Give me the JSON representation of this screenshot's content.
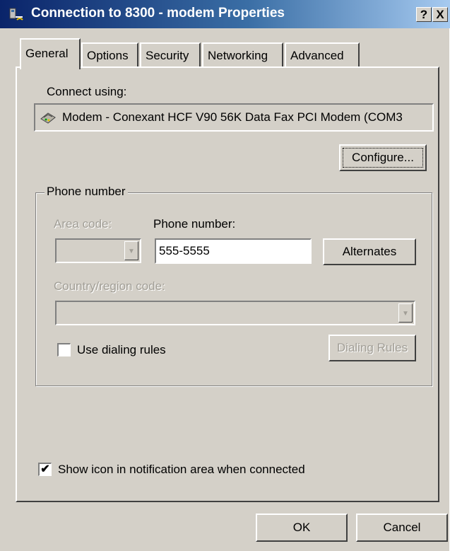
{
  "window": {
    "title": "Connection to 8300 - modem Properties",
    "help_label": "?",
    "close_label": "X"
  },
  "tabs": [
    {
      "label": "General",
      "active": true
    },
    {
      "label": "Options",
      "active": false
    },
    {
      "label": "Security",
      "active": false
    },
    {
      "label": "Networking",
      "active": false
    },
    {
      "label": "Advanced",
      "active": false
    }
  ],
  "general": {
    "connect_using_label": "Connect using:",
    "device_name": "Modem - Conexant HCF V90 56K Data Fax PCI Modem (COM3",
    "configure_label": "Configure..."
  },
  "phone": {
    "group_label": "Phone number",
    "area_code_label": "Area code:",
    "area_code_value": "",
    "phone_number_label": "Phone number:",
    "phone_number_value": "555-5555",
    "alternates_label": "Alternates",
    "country_label": "Country/region code:",
    "country_value": "",
    "use_dialing_rules_label": "Use dialing rules",
    "use_dialing_rules_checked": false,
    "dialing_rules_label": "Dialing Rules"
  },
  "notification": {
    "show_icon_label": "Show icon in notification area when connected",
    "checked": true,
    "check_glyph": "✔"
  },
  "footer": {
    "ok_label": "OK",
    "cancel_label": "Cancel"
  },
  "icons": {
    "title": "network-connection-icon",
    "device": "modem-icon"
  },
  "colors": {
    "title_gradient_start": "#0a246a",
    "title_gradient_end": "#a6caf0",
    "face": "#d4d0c8",
    "disabled_text": "#a19e96"
  }
}
